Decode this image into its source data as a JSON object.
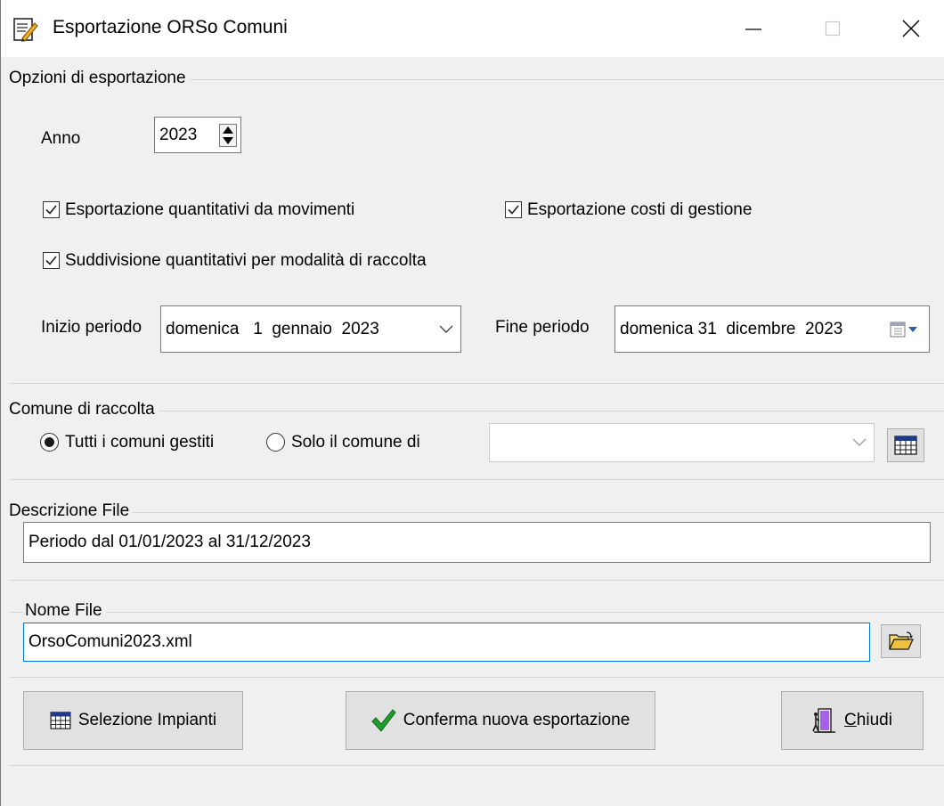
{
  "window": {
    "title": "Esportazione ORSo Comuni"
  },
  "options": {
    "group_title": "Opzioni di esportazione",
    "anno_label": "Anno",
    "anno_value": "2023",
    "chk_movimenti": {
      "label": "Esportazione quantitativi da movimenti",
      "checked": true
    },
    "chk_costi": {
      "label": "Esportazione costi di gestione",
      "checked": true
    },
    "chk_suddivisione": {
      "label": "Suddivisione quantitativi  per modalità di raccolta",
      "checked": true
    },
    "inizio_label": "Inizio periodo",
    "inizio_value": "domenica   1  gennaio  2023",
    "fine_label": "Fine periodo",
    "fine_value": "domenica 31  dicembre  2023"
  },
  "comune": {
    "group_title": "Comune di raccolta",
    "radio_tutti": "Tutti i comuni gestiti",
    "radio_solo": "Solo il comune di",
    "selected": "tutti",
    "comune_value": ""
  },
  "descrizione": {
    "group_title": "Descrizione File",
    "value": "Periodo dal 01/01/2023 al 31/12/2023"
  },
  "nome_file": {
    "group_title": "Nome File",
    "value": "OrsoComuni2023.xml"
  },
  "buttons": {
    "selezione": "Selezione Impianti",
    "conferma": "Conferma nuova esportazione",
    "chiudi_first": "C",
    "chiudi_rest": "hiudi"
  },
  "colors": {
    "accent": "#0078d7",
    "check_green": "#1f9e2c"
  }
}
